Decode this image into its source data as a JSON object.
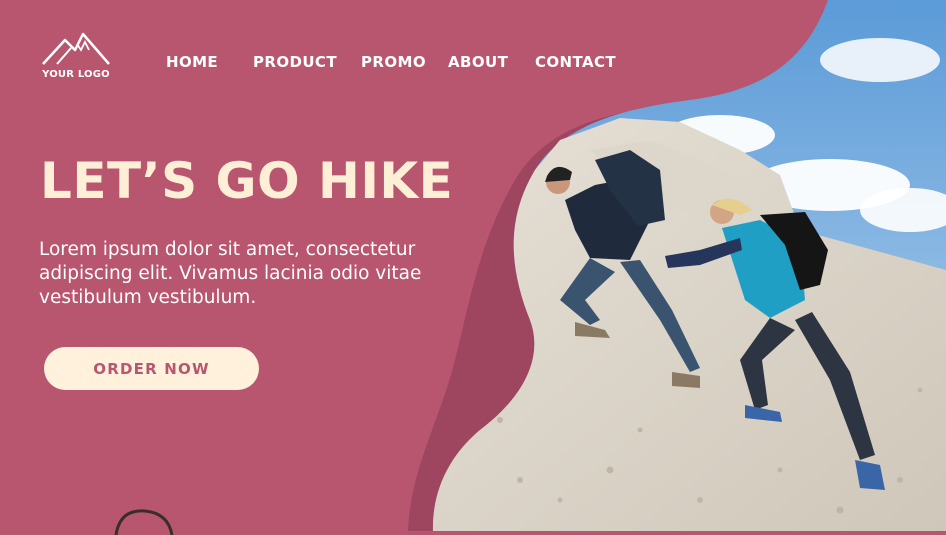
{
  "logo": {
    "text": "YOUR LOGO",
    "icon": "mountain-icon"
  },
  "nav": {
    "items": [
      {
        "label": "HOME"
      },
      {
        "label": "PRODUCT"
      },
      {
        "label": "PROMO"
      },
      {
        "label": "ABOUT"
      },
      {
        "label": "CONTACT"
      }
    ]
  },
  "hero": {
    "title": "LET’S GO HIKE",
    "description": "Lorem ipsum dolor sit amet, consectetur adipiscing elit. Vivamus lacinia odio vitae vestibulum vestibulum.",
    "cta_label": "ORDER NOW"
  },
  "colors": {
    "brand": "#b8566f",
    "accent": "#fff1dc",
    "text": "#ffffff"
  }
}
